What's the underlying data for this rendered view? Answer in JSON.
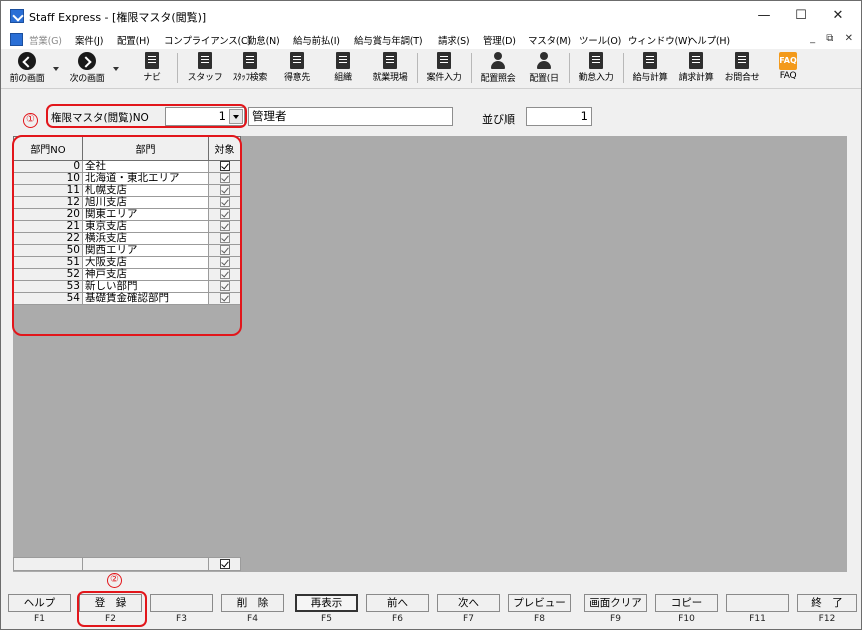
{
  "window": {
    "title": "Staff Express - [権限マスタ(閲覧)]",
    "controls": {
      "minimize": "—",
      "maximize": "☐",
      "close": "✕"
    }
  },
  "menubar": {
    "items": [
      {
        "label": "営業(G)",
        "disabled": true
      },
      {
        "label": "案件(J)"
      },
      {
        "label": "配置(H)"
      },
      {
        "label": "コンプライアンス(C)"
      },
      {
        "label": "勤怠(N)"
      },
      {
        "label": "給与前払(I)"
      },
      {
        "label": "給与賞与年調(T)"
      },
      {
        "label": "請求(S)"
      },
      {
        "label": "管理(D)"
      },
      {
        "label": "マスタ(M)"
      },
      {
        "label": "ツール(O)"
      },
      {
        "label": "ウィンドウ(W)"
      },
      {
        "label": "ヘルプ(H)"
      }
    ],
    "mdi_controls": "_ ⧉ ✕"
  },
  "toolbar": {
    "buttons": [
      {
        "label": "前の画面",
        "icon": "back-arrow-icon"
      },
      {
        "label": "次の画面",
        "icon": "forward-arrow-icon"
      },
      {
        "label": "ナビ",
        "icon": "navi-icon"
      },
      {
        "label": "スタッフ",
        "icon": "staff-icon"
      },
      {
        "label": "ｽﾀｯﾌ検索",
        "icon": "staff-search-icon"
      },
      {
        "label": "得意先",
        "icon": "customer-icon"
      },
      {
        "label": "組織",
        "icon": "organization-icon"
      },
      {
        "label": "就業現場",
        "icon": "worksite-icon"
      },
      {
        "label": "案件入力",
        "icon": "job-entry-icon"
      },
      {
        "label": "配置照会",
        "icon": "assignment-inquiry-icon"
      },
      {
        "label": "配置(日",
        "icon": "assignment-daily-icon"
      },
      {
        "label": "勤怠入力",
        "icon": "attendance-entry-icon"
      },
      {
        "label": "給与計算",
        "icon": "payroll-calc-icon"
      },
      {
        "label": "請求計算",
        "icon": "billing-calc-icon"
      },
      {
        "label": "お問合せ",
        "icon": "inquiry-icon"
      },
      {
        "label": "FAQ",
        "icon": "faq-icon"
      }
    ]
  },
  "form": {
    "permission_label": "権限マスタ(閲覧)NO",
    "permission_no": "1",
    "permission_name": "管理者",
    "sort_label": "並び順",
    "sort_value": "1",
    "annotation_1": "①",
    "annotation_2": "②"
  },
  "grid": {
    "headers": {
      "no": "部門NO",
      "name": "部門",
      "target": "対象"
    },
    "rows": [
      {
        "no": "0",
        "name": "全社",
        "checked": true
      },
      {
        "no": "10",
        "name": "北海道・東北エリア",
        "checked": true
      },
      {
        "no": "11",
        "name": "札幌支店",
        "checked": true
      },
      {
        "no": "12",
        "name": "旭川支店",
        "checked": true
      },
      {
        "no": "20",
        "name": "関東エリア",
        "checked": true
      },
      {
        "no": "21",
        "name": "東京支店",
        "checked": true
      },
      {
        "no": "22",
        "name": "横浜支店",
        "checked": true
      },
      {
        "no": "50",
        "name": "関西エリア",
        "checked": true
      },
      {
        "no": "51",
        "name": "大阪支店",
        "checked": true
      },
      {
        "no": "52",
        "name": "神戸支店",
        "checked": true
      },
      {
        "no": "53",
        "name": "新しい部門",
        "checked": true
      },
      {
        "no": "54",
        "name": "基礎賃金確認部門",
        "checked": true
      }
    ],
    "footer_checked": true
  },
  "fkeys": [
    {
      "key": "F1",
      "label": "ヘルプ"
    },
    {
      "key": "F2",
      "label": "登　録"
    },
    {
      "key": "F3",
      "label": ""
    },
    {
      "key": "F4",
      "label": "削　除"
    },
    {
      "key": "F5",
      "label": "再表示"
    },
    {
      "key": "F6",
      "label": "前へ"
    },
    {
      "key": "F7",
      "label": "次へ"
    },
    {
      "key": "F8",
      "label": "プレビュー"
    },
    {
      "key": "F9",
      "label": "画面クリア"
    },
    {
      "key": "F10",
      "label": "コピー"
    },
    {
      "key": "F11",
      "label": ""
    },
    {
      "key": "F12",
      "label": "終　了"
    }
  ],
  "colors": {
    "annotation_red": "#e2161b",
    "grid_bg": "#ababab"
  }
}
